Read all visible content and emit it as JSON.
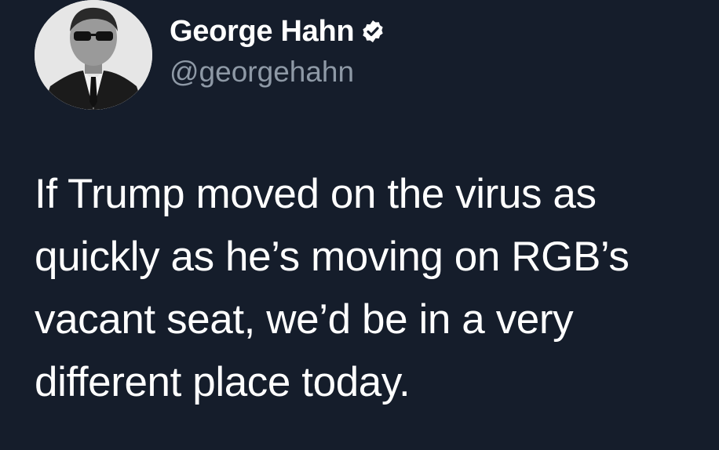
{
  "author": {
    "display_name": "George Hahn",
    "handle": "@georgehahn",
    "verified": true,
    "verified_icon": "verified-badge-icon",
    "avatar_icon": "profile-photo"
  },
  "tweet": {
    "lines": [
      "If Trump moved on the virus as",
      "quickly as he’s moving on RGB’s",
      "vacant seat, we’d be in a very",
      "different place today."
    ]
  },
  "colors": {
    "background": "#151d2b",
    "text": "#ffffff",
    "handle": "#8e99a6"
  }
}
